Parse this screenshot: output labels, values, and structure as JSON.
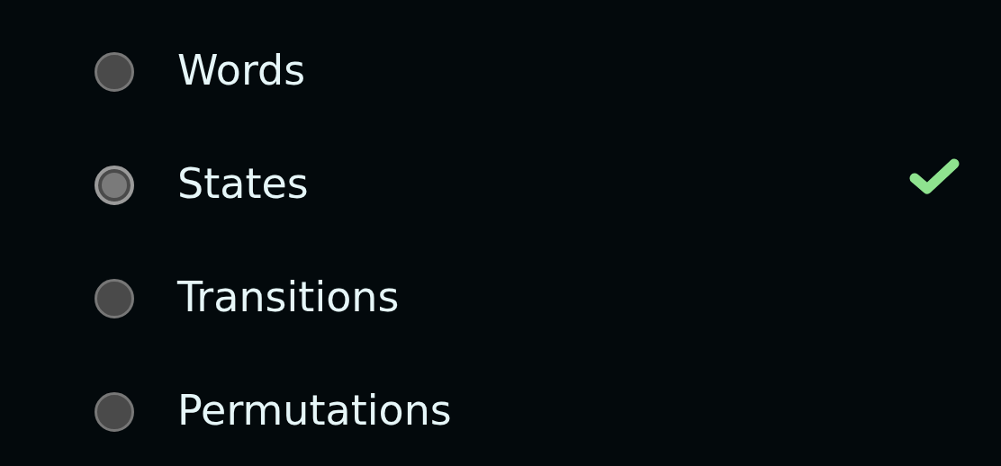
{
  "options": [
    {
      "label": "Words",
      "selected": false,
      "correct": false
    },
    {
      "label": "States",
      "selected": true,
      "correct": true
    },
    {
      "label": "Transitions",
      "selected": false,
      "correct": false
    },
    {
      "label": "Permutations",
      "selected": false,
      "correct": false
    }
  ]
}
